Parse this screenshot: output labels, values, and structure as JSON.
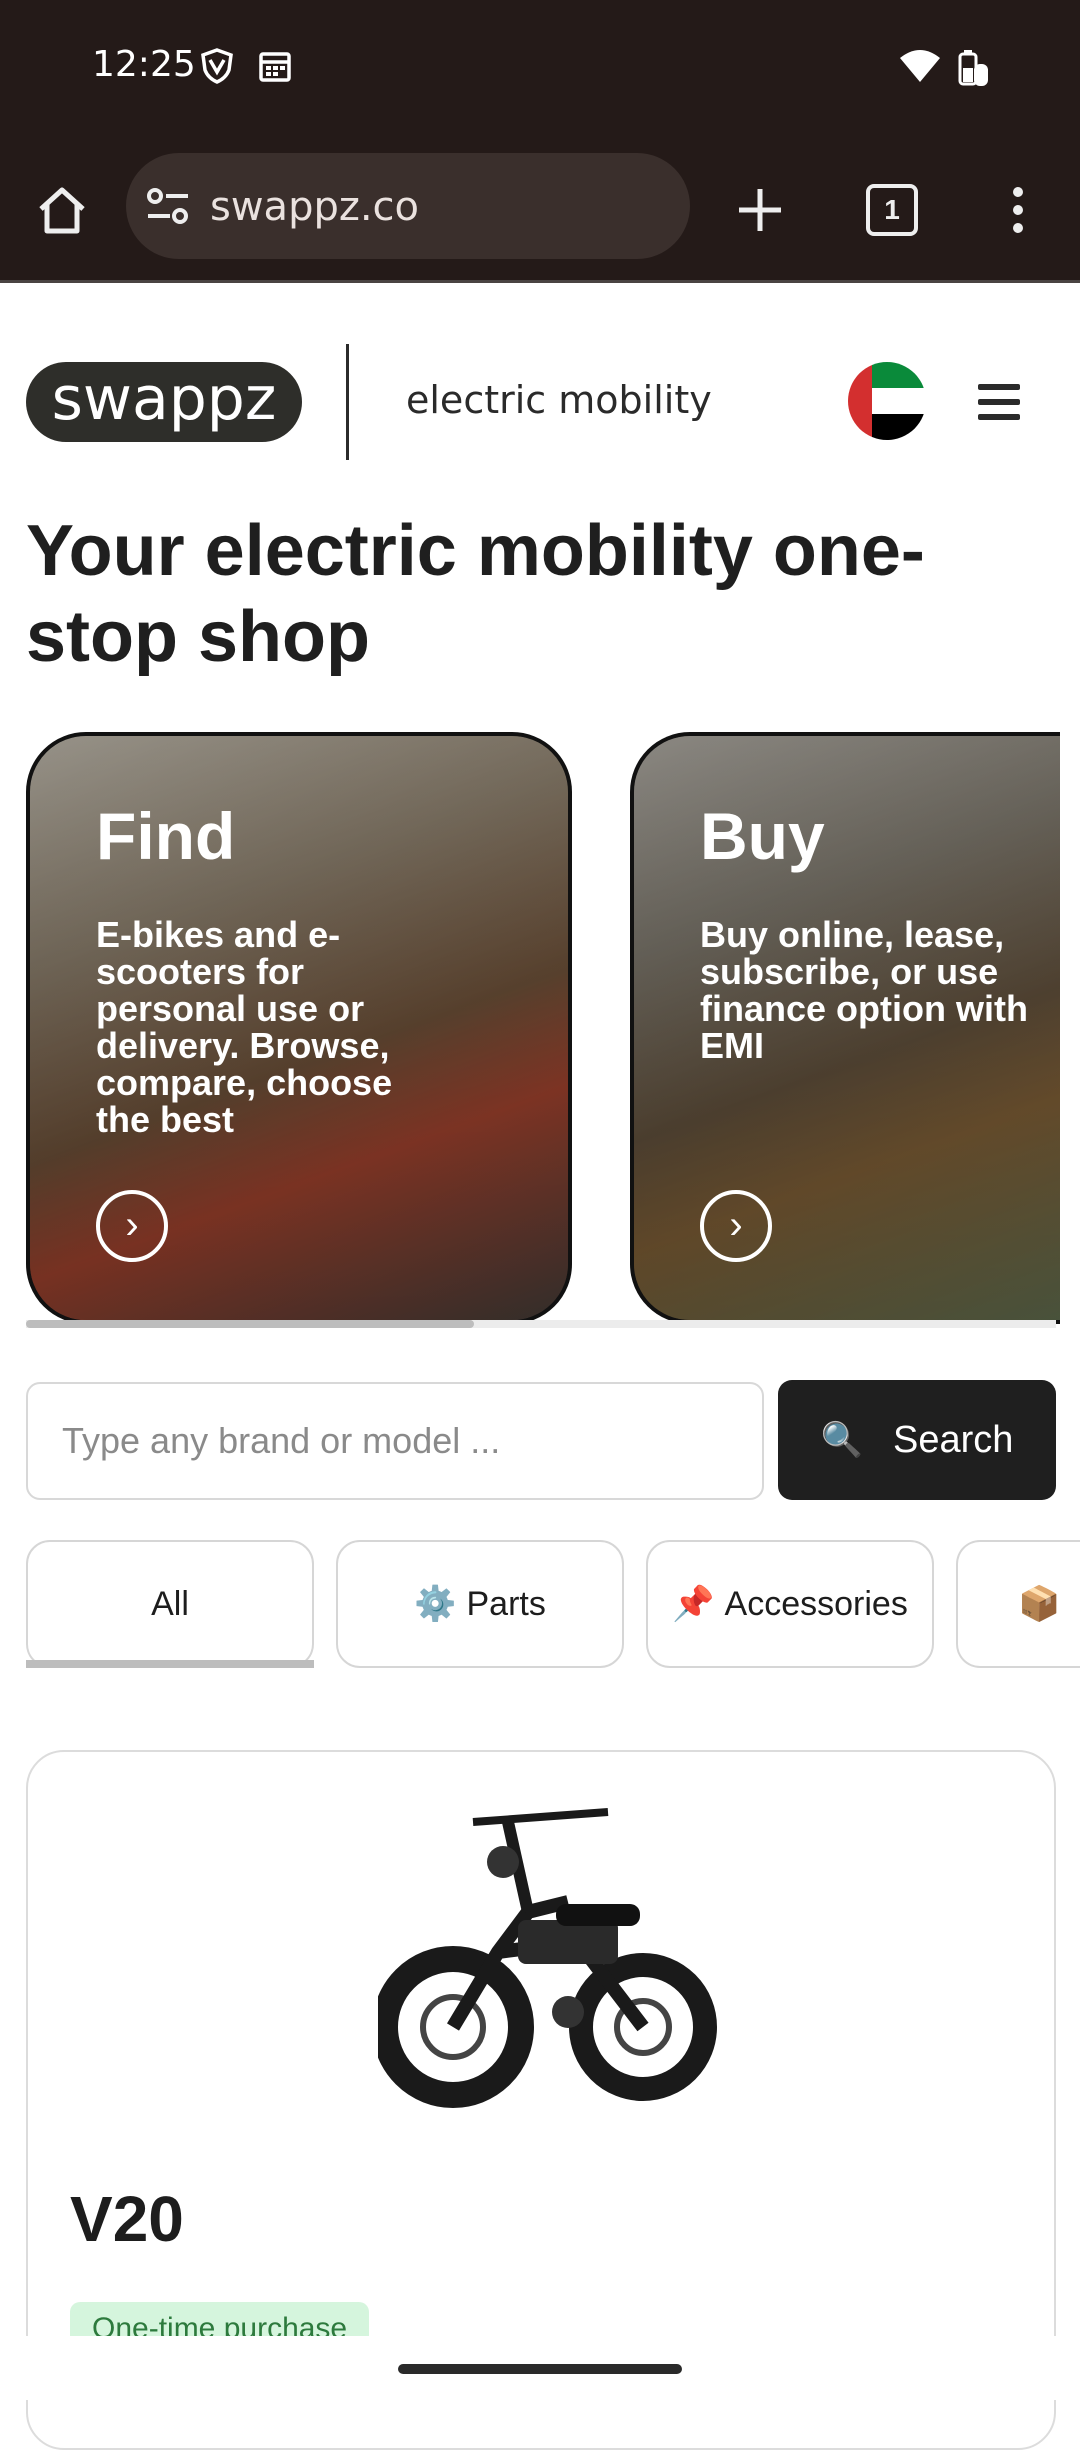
{
  "status_bar": {
    "time": "12:25",
    "icons": [
      "shield-icon",
      "calendar-icon",
      "wifi-icon",
      "battery-icon"
    ]
  },
  "browser": {
    "url": "swappz.co",
    "tab_count": "1",
    "icons": [
      "home-icon",
      "site-settings-icon",
      "new-tab-icon",
      "tab-switcher-icon",
      "more-vert-icon"
    ]
  },
  "header": {
    "logo": "swappz",
    "tagline": "electric mobility",
    "flag": "uae-flag",
    "colors": {
      "flag_red": "#d32f2f",
      "flag_green": "#0a8a3a",
      "flag_black": "#000000"
    }
  },
  "headline": "Your electric mobility one-stop shop",
  "cards": [
    {
      "title": "Find",
      "description": "E-bikes and e-scooters for personal use or delivery. Browse, compare, choose the best"
    },
    {
      "title": "Buy",
      "description": "Buy online, lease, subscribe, or use finance option with EMI"
    }
  ],
  "search": {
    "placeholder": "Type any brand or model ...",
    "button_label": "Search",
    "button_icon": "🔍"
  },
  "filters": {
    "tabs": [
      {
        "label": "All",
        "icon": ""
      },
      {
        "label": "Parts",
        "icon": "⚙️"
      },
      {
        "label": "Accessories",
        "icon": "📌"
      },
      {
        "label": "",
        "icon": "📦"
      }
    ],
    "active": "All"
  },
  "product": {
    "name": "V20",
    "badge": "One-time purchase"
  }
}
